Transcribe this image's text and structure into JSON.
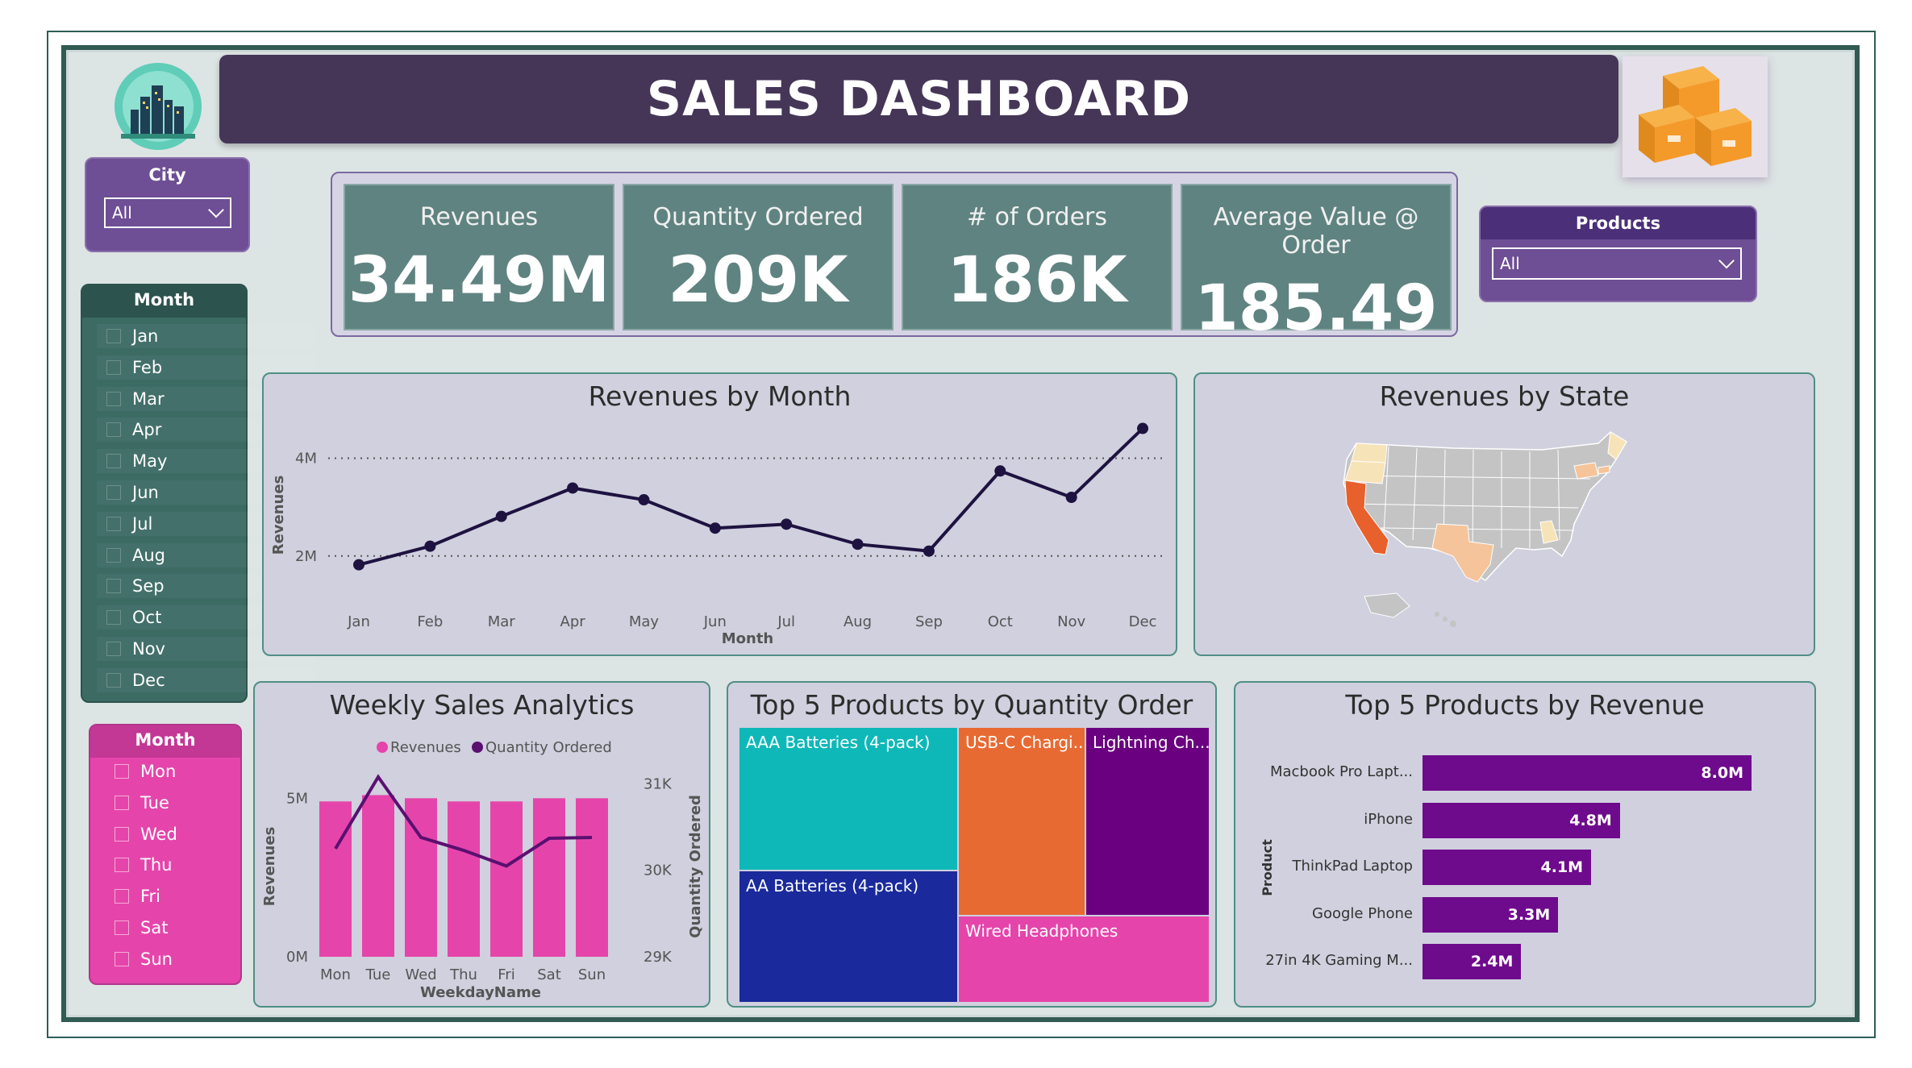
{
  "header": {
    "title": "SALES DASHBOARD"
  },
  "city_slicer": {
    "label": "City",
    "value": "All"
  },
  "products_slicer": {
    "label": "Products",
    "value": "All"
  },
  "month_slicer": {
    "label": "Month",
    "items": [
      "Jan",
      "Feb",
      "Mar",
      "Apr",
      "May",
      "Jun",
      "Jul",
      "Aug",
      "Sep",
      "Oct",
      "Nov",
      "Dec"
    ]
  },
  "weekday_slicer": {
    "label": "Month",
    "items": [
      "Mon",
      "Tue",
      "Wed",
      "Thu",
      "Fri",
      "Sat",
      "Sun"
    ]
  },
  "kpis": [
    {
      "label": "Revenues",
      "value": "34.49M"
    },
    {
      "label": "Quantity Ordered",
      "value": "209K"
    },
    {
      "label": "# of Orders",
      "value": "186K"
    },
    {
      "label": "Average Value @ Order",
      "value": "185.49"
    }
  ],
  "colors": {
    "banner": "#453658",
    "slicer_purple": "#6e4e94",
    "slicer_teal": "#3c6b64",
    "slicer_pink": "#e545ab",
    "kpi": "#5f8380",
    "line": "#1e1240",
    "bar_pink": "#e545ab",
    "bar_purple": "#6e0a8c",
    "tm_teal": "#0fb8b8",
    "tm_orange": "#e86a33",
    "tm_purple": "#6a0080",
    "tm_navy": "#1a2a9c",
    "tm_pink": "#e545ab",
    "map_default": "#c4c4c4",
    "map_high": "#e8602c",
    "map_mid": "#f5c49a",
    "map_low": "#f7e3b8"
  },
  "icons": {
    "logo": "city-icon",
    "boxes": "boxes-icon"
  },
  "charts": [
    {
      "title": "Revenues by Month",
      "chart_data": {
        "type": "line",
        "title": "Revenues by Month",
        "xlabel": "Month",
        "ylabel": "Revenues",
        "categories": [
          "Jan",
          "Feb",
          "Mar",
          "Apr",
          "May",
          "Jun",
          "Jul",
          "Aug",
          "Sep",
          "Oct",
          "Nov",
          "Dec"
        ],
        "values": [
          1.82,
          2.2,
          2.81,
          3.39,
          3.15,
          2.57,
          2.65,
          2.24,
          2.1,
          3.74,
          3.2,
          4.61
        ],
        "yticks": [
          "2M",
          "4M"
        ],
        "ylim": [
          1.6,
          4.8
        ],
        "grid": true
      }
    },
    {
      "title": "Revenues by State",
      "chart_data": {
        "type": "map",
        "title": "Revenues by State",
        "regions": [
          {
            "name": "California",
            "level": "high"
          },
          {
            "name": "Texas",
            "level": "mid"
          },
          {
            "name": "New York",
            "level": "mid"
          },
          {
            "name": "Massachusetts",
            "level": "mid"
          },
          {
            "name": "Georgia",
            "level": "low"
          },
          {
            "name": "Washington",
            "level": "low"
          },
          {
            "name": "Oregon",
            "level": "low"
          },
          {
            "name": "Maine",
            "level": "low"
          }
        ]
      }
    },
    {
      "title": "Weekly Sales Analytics",
      "chart_data": {
        "type": "bar",
        "title": "Weekly Sales Analytics",
        "xlabel": "WeekdayName",
        "ylabel": "Revenues",
        "y2label": "Quantity Ordered",
        "categories": [
          "Mon",
          "Tue",
          "Wed",
          "Thu",
          "Fri",
          "Sat",
          "Sun"
        ],
        "legend": [
          "Revenues",
          "Quantity Ordered"
        ],
        "series": [
          {
            "name": "Revenues",
            "values": [
              4.9,
              5.1,
              5.0,
              4.9,
              4.9,
              5.0,
              5.0
            ]
          },
          {
            "name": "Quantity Ordered",
            "values": [
              30250,
              31080,
              30380,
              30230,
              30050,
              30370,
              30380
            ]
          }
        ],
        "yticks": [
          "0M",
          "5M"
        ],
        "y2ticks": [
          "29K",
          "30K",
          "31K"
        ],
        "ylim": [
          0,
          6.0
        ],
        "y2lim": [
          29000,
          31200
        ]
      }
    },
    {
      "title": "Top 5 Products by Quantity Order",
      "chart_data": {
        "type": "treemap",
        "title": "Top 5 Products by Quantity Order",
        "items": [
          {
            "label": "AAA Batteries (4-pack)"
          },
          {
            "label": "AA Batteries (4-pack)"
          },
          {
            "label": "USB-C Chargi..."
          },
          {
            "label": "Lightning Ch..."
          },
          {
            "label": "Wired Headphones"
          }
        ]
      }
    },
    {
      "title": "Top 5 Products by Revenue",
      "chart_data": {
        "type": "bar",
        "orientation": "horizontal",
        "title": "Top 5 Products by Revenue",
        "ylabel": "Product",
        "categories": [
          "Macbook Pro Lapt...",
          "iPhone",
          "ThinkPad Laptop",
          "Google Phone",
          "27in 4K Gaming M..."
        ],
        "values": [
          8.0,
          4.8,
          4.1,
          3.3,
          2.4
        ],
        "value_labels": [
          "8.0M",
          "4.8M",
          "4.1M",
          "3.3M",
          "2.4M"
        ]
      }
    }
  ]
}
